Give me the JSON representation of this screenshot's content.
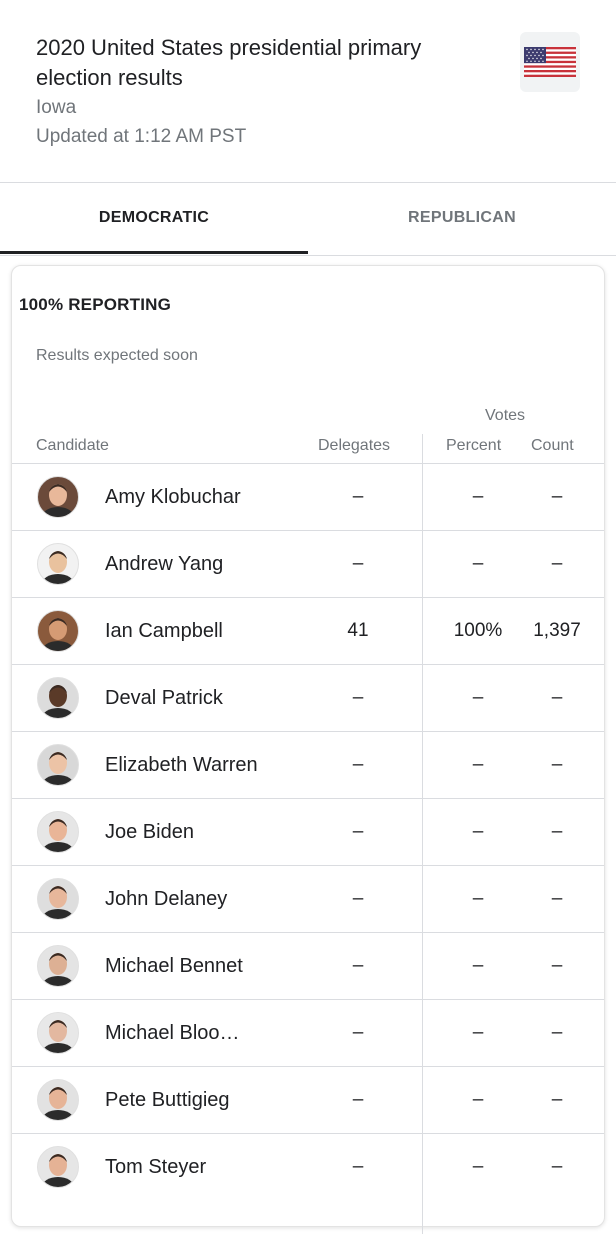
{
  "header": {
    "title": "2020 United States presidential primary election results",
    "state": "Iowa",
    "updated": "Updated at 1:12 AM PST",
    "flag_icon": "us-flag"
  },
  "tabs": [
    {
      "label": "DEMOCRATIC",
      "active": true
    },
    {
      "label": "REPUBLICAN",
      "active": false
    }
  ],
  "results": {
    "reporting": "100% REPORTING",
    "note": "Results expected soon",
    "headers": {
      "candidate": "Candidate",
      "delegates": "Delegates",
      "votes": "Votes",
      "percent": "Percent",
      "count": "Count"
    },
    "candidates": [
      {
        "name": "Amy Klobuchar",
        "delegates": "–",
        "percent": "–",
        "count": "–",
        "avatar_bg": "#6b4a3a",
        "skin": "#e8b89a"
      },
      {
        "name": "Andrew Yang",
        "delegates": "–",
        "percent": "–",
        "count": "–",
        "avatar_bg": "#f2f2f2",
        "skin": "#e9c29e"
      },
      {
        "name": "Ian Campbell",
        "delegates": "41",
        "percent": "100%",
        "count": "1,397",
        "avatar_bg": "#8a5a3c",
        "skin": "#d59b74"
      },
      {
        "name": "Deval Patrick",
        "delegates": "–",
        "percent": "–",
        "count": "–",
        "avatar_bg": "#dcdcdc",
        "skin": "#5a3a28"
      },
      {
        "name": "Elizabeth Warren",
        "delegates": "–",
        "percent": "–",
        "count": "–",
        "avatar_bg": "#d8d8d8",
        "skin": "#ecc3a6"
      },
      {
        "name": "Joe Biden",
        "delegates": "–",
        "percent": "–",
        "count": "–",
        "avatar_bg": "#e6e6e6",
        "skin": "#e9b597"
      },
      {
        "name": "John Delaney",
        "delegates": "–",
        "percent": "–",
        "count": "–",
        "avatar_bg": "#dedede",
        "skin": "#e7b79b"
      },
      {
        "name": "Michael Bennet",
        "delegates": "–",
        "percent": "–",
        "count": "–",
        "avatar_bg": "#e4e4e4",
        "skin": "#ddb094"
      },
      {
        "name": "Michael Bloo…",
        "delegates": "–",
        "percent": "–",
        "count": "–",
        "avatar_bg": "#e8e8e8",
        "skin": "#e3b8a0"
      },
      {
        "name": "Pete Buttigieg",
        "delegates": "–",
        "percent": "–",
        "count": "–",
        "avatar_bg": "#e2e2e2",
        "skin": "#e6b497"
      },
      {
        "name": "Tom Steyer",
        "delegates": "–",
        "percent": "–",
        "count": "–",
        "avatar_bg": "#e6e6e6",
        "skin": "#e5b295"
      }
    ]
  }
}
